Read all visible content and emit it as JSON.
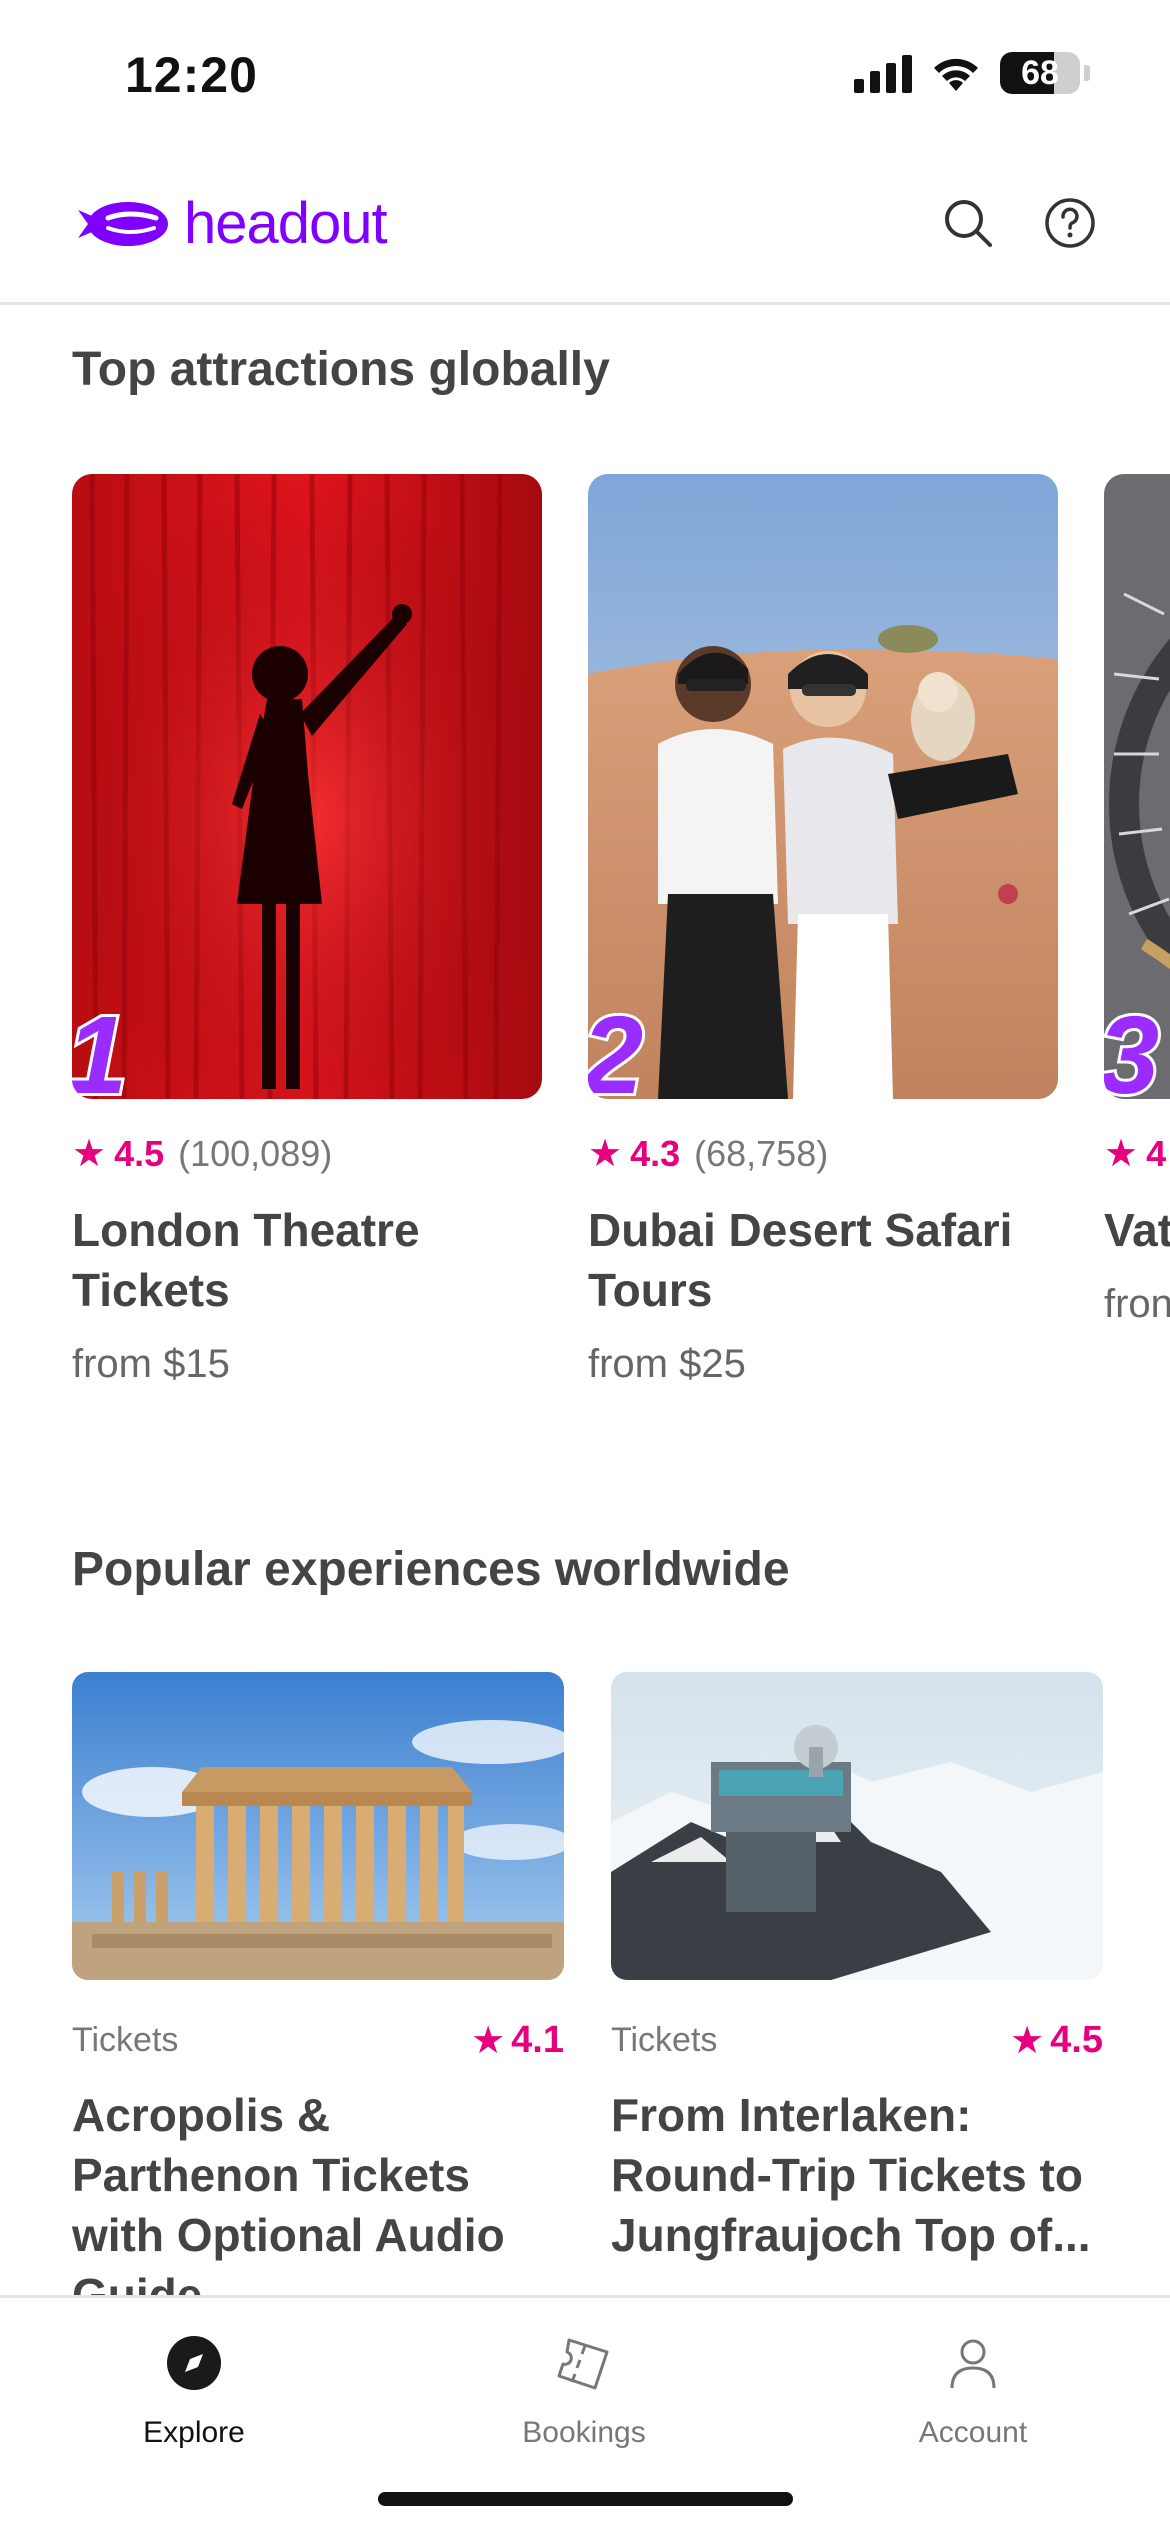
{
  "status_bar": {
    "time": "12:20",
    "battery_level": "68",
    "battery_fraction": 0.68
  },
  "header": {
    "brand": "headout",
    "brand_color": "#8000ff"
  },
  "top_attractions": {
    "title": "Top attractions globally",
    "cards": [
      {
        "rank": "1",
        "rating": "4.5",
        "reviews": "(100,089)",
        "title": "London Theatre Tickets",
        "price": "from $15",
        "image": "red-curtain-silhouette"
      },
      {
        "rank": "2",
        "rating": "4.3",
        "reviews": "(68,758)",
        "title": "Dubai Desert Safari Tours",
        "price": "from $25",
        "image": "desert-with-owl"
      },
      {
        "rank": "3",
        "rating": "4",
        "reviews": "",
        "title": "Vat",
        "price": "fron",
        "image": "vatican-staircase"
      }
    ]
  },
  "popular_experiences": {
    "title": "Popular experiences worldwide",
    "cards": [
      {
        "category": "Tickets",
        "rating": "4.1",
        "title": "Acropolis & Parthenon Tickets with Optional Audio Guide",
        "image": "parthenon"
      },
      {
        "category": "Tickets",
        "rating": "4.5",
        "title": "From Interlaken: Round-Trip Tickets to Jungfraujoch Top of...",
        "image": "jungfraujoch"
      }
    ]
  },
  "bottom_nav": {
    "items": [
      {
        "label": "Explore",
        "icon": "compass-icon",
        "active": true
      },
      {
        "label": "Bookings",
        "icon": "ticket-icon",
        "active": false
      },
      {
        "label": "Account",
        "icon": "person-icon",
        "active": false
      }
    ]
  },
  "colors": {
    "accent": "#8000ff",
    "rating": "#e6007e",
    "rank": "#9a2cff"
  }
}
